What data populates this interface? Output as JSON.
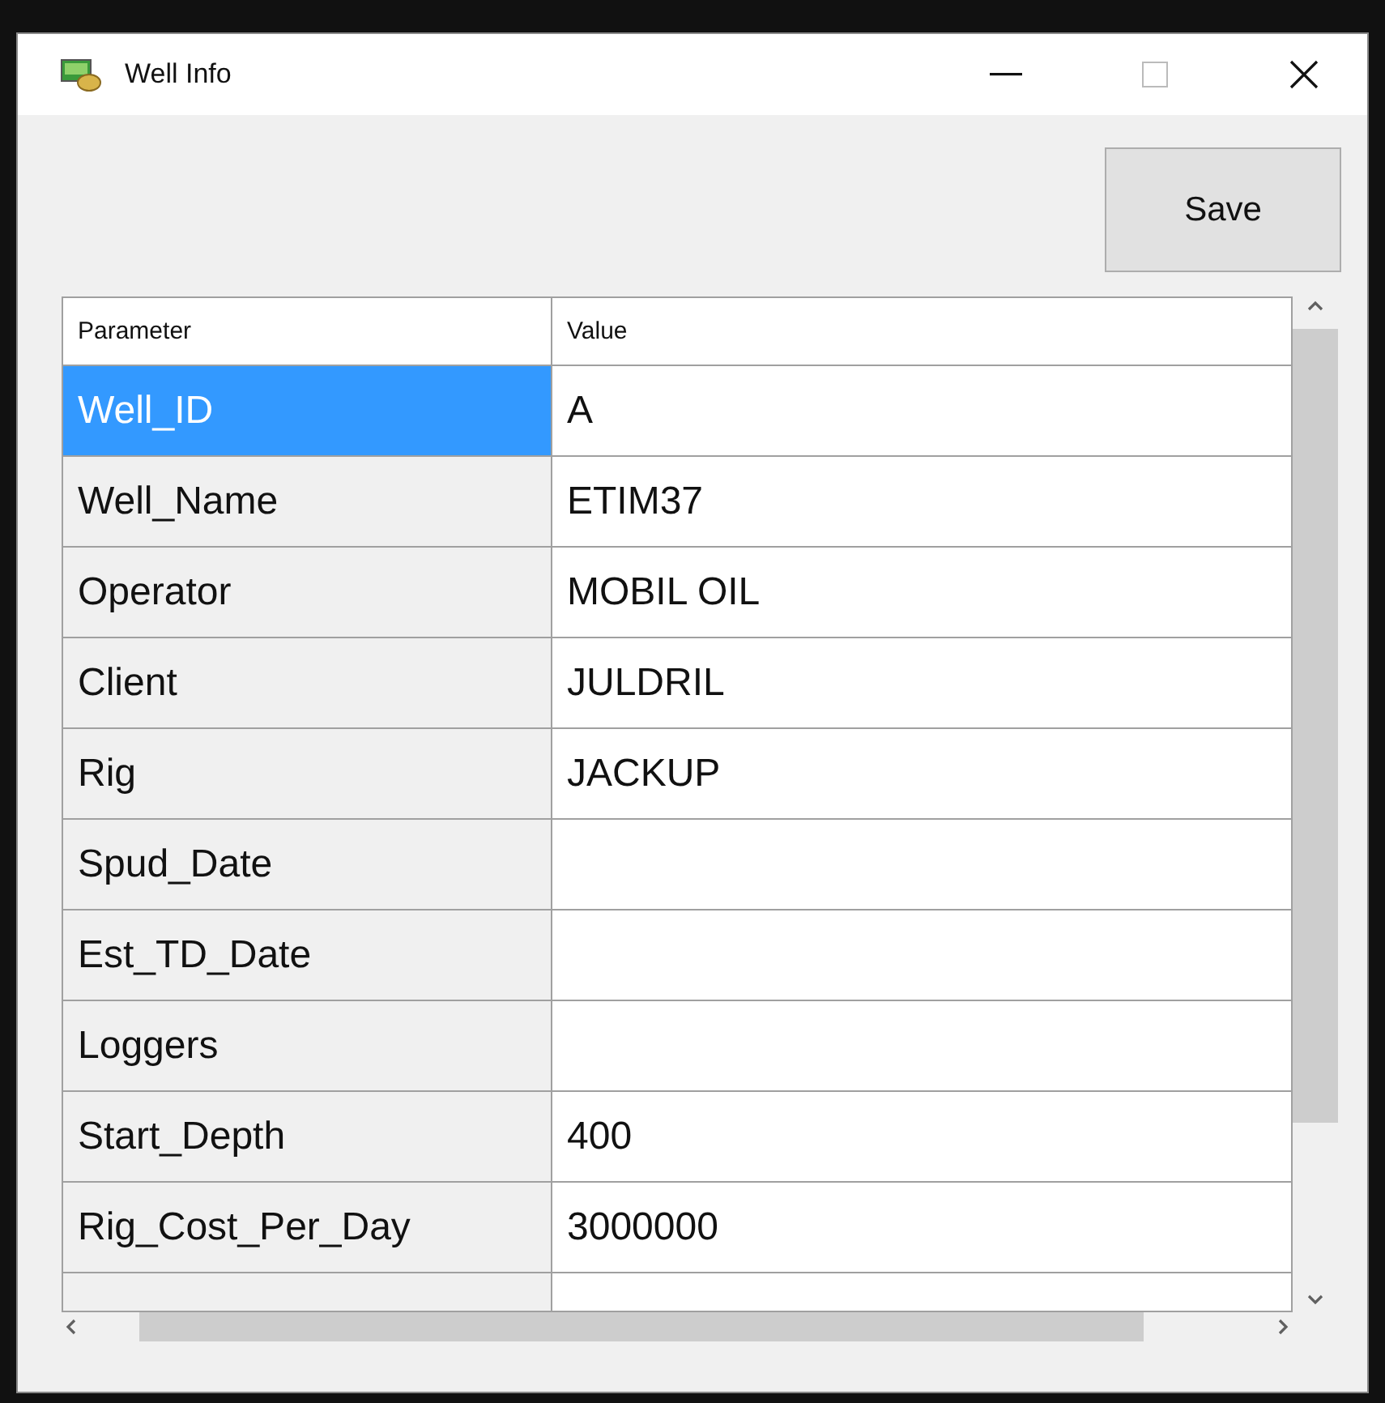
{
  "window": {
    "title": "Well Info"
  },
  "save_button": "Save",
  "table": {
    "columns": [
      "Parameter",
      "Value"
    ],
    "rows": [
      {
        "parameter": "Well_ID",
        "value": "A",
        "selected": true
      },
      {
        "parameter": "Well_Name",
        "value": "ETIM37",
        "selected": false
      },
      {
        "parameter": "Operator",
        "value": "MOBIL OIL",
        "selected": false
      },
      {
        "parameter": "Client",
        "value": "JULDRIL",
        "selected": false
      },
      {
        "parameter": "Rig",
        "value": "JACKUP",
        "selected": false
      },
      {
        "parameter": "Spud_Date",
        "value": "",
        "selected": false
      },
      {
        "parameter": "Est_TD_Date",
        "value": "",
        "selected": false
      },
      {
        "parameter": "Loggers",
        "value": "",
        "selected": false
      },
      {
        "parameter": "Start_Depth",
        "value": "400",
        "selected": false
      },
      {
        "parameter": "Rig_Cost_Per_Day",
        "value": "3000000",
        "selected": false
      }
    ]
  }
}
